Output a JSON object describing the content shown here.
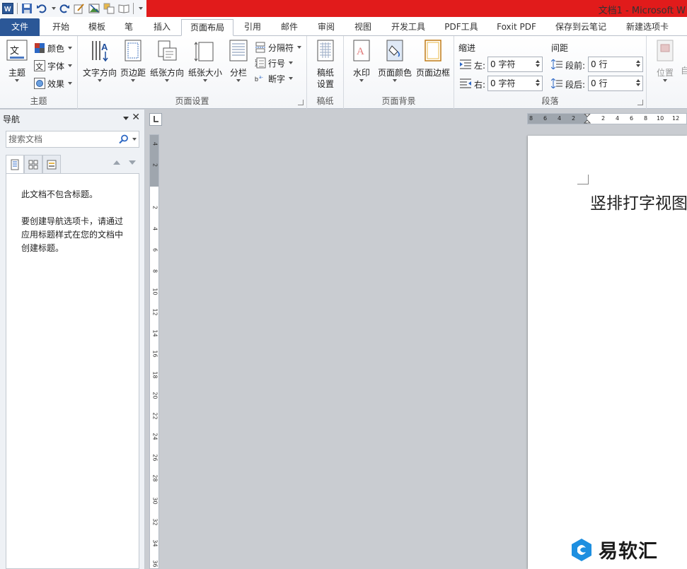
{
  "window": {
    "title": "文档1 - Microsoft W"
  },
  "tabs": [
    "文件",
    "开始",
    "模板",
    "笔",
    "插入",
    "页面布局",
    "引用",
    "邮件",
    "审阅",
    "视图",
    "开发工具",
    "PDF工具",
    "Foxit PDF",
    "保存到云笔记",
    "新建选项卡"
  ],
  "active_tab": "页面布局",
  "ribbon": {
    "theme": {
      "label": "主题",
      "btn": "主题",
      "colors": "颜色",
      "fonts": "字体",
      "effects": "效果"
    },
    "page_setup": {
      "label": "页面设置",
      "text_direction": "文字方向",
      "margins": "页边距",
      "orientation": "纸张方向",
      "size": "纸张大小",
      "columns": "分栏",
      "breaks": "分隔符",
      "line_numbers": "行号",
      "hyphenation": "断字"
    },
    "manuscript": {
      "label": "稿纸",
      "btn_line1": "稿纸",
      "btn_line2": "设置"
    },
    "background": {
      "label": "页面背景",
      "watermark": "水印",
      "page_color": "页面颜色",
      "page_borders": "页面边框"
    },
    "paragraph": {
      "label": "段落",
      "indent_title": "缩进",
      "spacing_title": "间距",
      "left_label": "左:",
      "right_label": "右:",
      "before_label": "段前:",
      "after_label": "段后:",
      "left_value": "0 字符",
      "right_value": "0 字符",
      "before_value": "0 行",
      "after_value": "0 行"
    },
    "arrange": {
      "position": "位置",
      "wrap_partial": "自"
    }
  },
  "nav": {
    "title": "导航",
    "search_placeholder": "搜索文档",
    "empty_line1": "此文档不包含标题。",
    "empty_line2": "要创建导航选项卡，请通过应用标题样式在您的文档中创建标题。"
  },
  "ruler": {
    "horizontal": [
      "8",
      "6",
      "4",
      "2",
      "2",
      "4",
      "6",
      "8",
      "10",
      "12"
    ],
    "vertical": [
      "4",
      "2",
      "2",
      "4",
      "6",
      "8",
      "10",
      "12",
      "14",
      "16",
      "18",
      "20",
      "22",
      "24",
      "26",
      "28",
      "30",
      "32",
      "34",
      "36"
    ]
  },
  "document": {
    "text": "竖排打字视图"
  },
  "watermark": {
    "text": "易软汇"
  },
  "colors": {
    "title_bar": "#e11b1b",
    "file_tab": "#2b5797",
    "canvas": "#c9ccd1",
    "watermark_logo": "#1e8fe0"
  }
}
